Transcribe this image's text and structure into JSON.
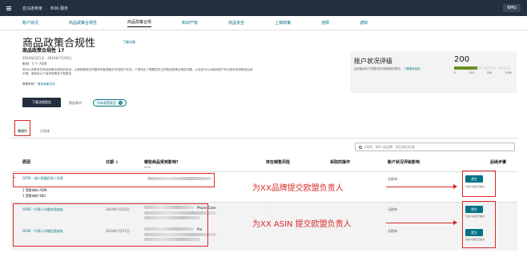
{
  "topbar": {
    "brand_1": "亚马逊卖家",
    "brand_2": "BOK 服务",
    "right": "BMG"
  },
  "subnav": {
    "items": [
      "账户状况",
      "商品政策合规性",
      "商品政策合规",
      "知识产权",
      "商品安全",
      "上架政策",
      "违规",
      "通知"
    ],
    "active_index": 2
  },
  "page": {
    "title": "商品政策合规性",
    "title_link": "了解详情",
    "subtitle": "商品政策合规性 17",
    "date_range": "2024年2月1日 - 2024年7月29日",
    "count": "影响：0 个 ASIN",
    "desc": "您可以查看有关商品政策合规性的信息，以便按照我们的要求采取措施并改进账户状况。下表列出了需要您关注的商品政策合规性问题，以及您可以为维持账户状况良好而采取的后续步骤。请使用以下选项查看和下载报告。",
    "help_prefix": "需要帮助？",
    "help_link": "联系卖家支持"
  },
  "controls": {
    "download": "下载违规报告",
    "filter_label": "筛选条件：",
    "chip": "所有政策类型",
    "chip_close": "×"
  },
  "score": {
    "title": "账户状况评级",
    "desc": "此评级反映了您遵守亚马逊政策的情况。",
    "desc_link": "了解更多信息",
    "value": 200,
    "max": 1000,
    "ticks": [
      "0",
      "100",
      "200",
      "1000"
    ]
  },
  "tabs": [
    {
      "label": "需操作"
    },
    {
      "label": "已完成"
    }
  ],
  "search": {
    "placeholder": "ASIN、SKU 或品牌，然后按回车键"
  },
  "columns": {
    "reason": "原因",
    "date": "日期 ↓",
    "impact": "哪些商品受到影响？",
    "impact_sub": "ASIN",
    "sales_risk": "存在销售风险",
    "action": "采取的操作",
    "health": "账户状况评级影响",
    "next": "后续步骤"
  },
  "rows": [
    {
      "reason": "GPSR - 缺少欧盟负责人信息",
      "extra_1": "1 受影响的 ASIN",
      "extra_2": "1 受影响的 SKU",
      "date": "",
      "sales_risk": "",
      "action": "",
      "health": "无影响",
      "next_button": "提交",
      "next_note": "负责人信息已提交"
    },
    {
      "reason": "GPSR - 代表人详细信息缺失",
      "date": "2024年7月25日",
      "item_title": "Phone Case",
      "sales_risk": "-",
      "action": "",
      "health": "无影响",
      "next_button": "提交",
      "next_note": "负责人信息已提交"
    },
    {
      "reason": "GPSR - 代表人详细信息缺失",
      "date": "2024年7月27日",
      "item_title": "Pro",
      "sales_risk": "",
      "action": "",
      "health": "无影响",
      "next_button": "提交",
      "next_note": "负责人信息已提交"
    }
  ],
  "annotations": {
    "brand_note": "为XX品牌提交欧盟负责人",
    "asin_note": "为XX ASIN 提交欧盟负责人"
  },
  "colors": {
    "accent": "#007185",
    "header": "#232f3e",
    "annotation": "#d92a2a"
  }
}
